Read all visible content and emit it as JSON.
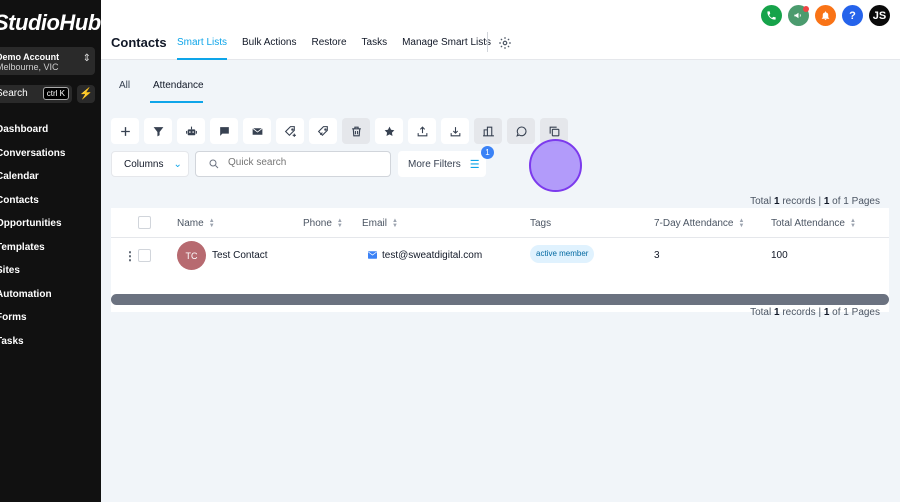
{
  "sidebar": {
    "logo": "StudioHub",
    "account_name": "Demo Account",
    "account_location": "Melbourne, VIC",
    "search_label": "Search",
    "search_shortcut": "ctrl K",
    "nav_items": [
      "Dashboard",
      "Conversations",
      "Calendar",
      "Contacts",
      "Opportunities",
      "Templates",
      "Sites",
      "Automation",
      "Forms",
      "Tasks"
    ]
  },
  "header": {
    "title": "Contacts",
    "tabs": [
      "Smart Lists",
      "Bulk Actions",
      "Restore",
      "Tasks",
      "Manage Smart Lists"
    ],
    "active_tab": "Smart Lists",
    "user_initials": "JS",
    "help_label": "?",
    "colors": {
      "phone": "#16a34a",
      "megaphone": "#4b9b6e",
      "bell": "#f97316",
      "help": "#2563eb",
      "user": "#0a0a0a",
      "accent": "#0ea5e9"
    }
  },
  "subtabs": [
    "All",
    "Attendance"
  ],
  "active_subtab": "Attendance",
  "toolbar_icons": [
    "plus-icon",
    "filter-icon",
    "robot-icon",
    "message-icon",
    "email-icon",
    "add-tag-icon",
    "remove-tag-icon",
    "delete-icon",
    "star-icon",
    "export-icon",
    "import-icon",
    "company-icon",
    "whatsapp-icon",
    "duplicate-icon"
  ],
  "filters": {
    "columns_label": "Columns",
    "search_placeholder": "Quick search",
    "more_filters_label": "More Filters",
    "more_filters_count": "1"
  },
  "records": {
    "prefix": "Total ",
    "count": "1",
    "records_word": " records | ",
    "page": "1",
    "pages_text": " of 1 Pages"
  },
  "table": {
    "columns": [
      "Name",
      "Phone",
      "Email",
      "Tags",
      "7-Day Attendance",
      "Total Attendance"
    ],
    "rows": [
      {
        "initials": "TC",
        "name": "Test Contact",
        "phone": "",
        "email": "test@sweatdigital.com",
        "tag": "active member",
        "attendance_7day": "3",
        "attendance_total": "100"
      }
    ]
  }
}
